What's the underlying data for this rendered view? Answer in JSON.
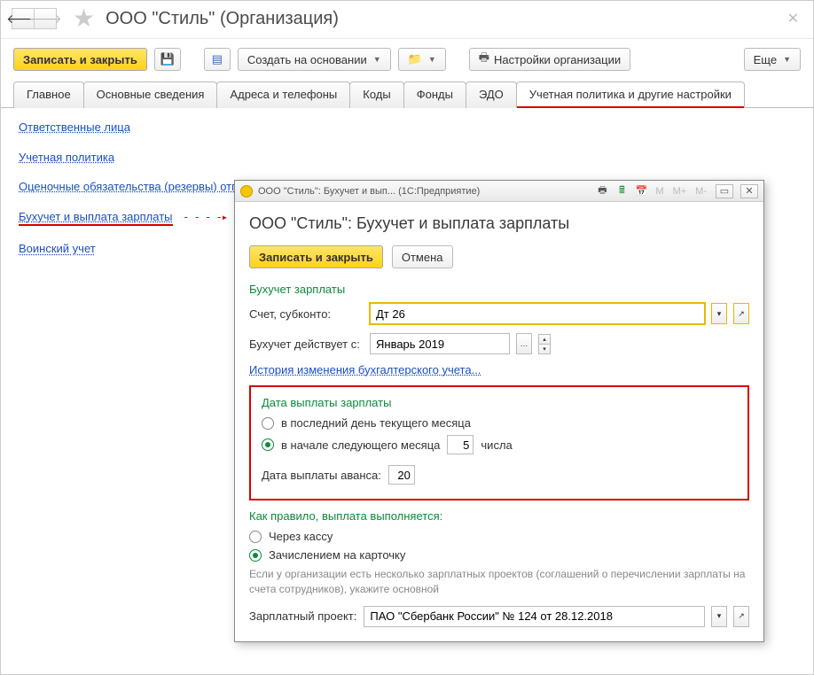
{
  "header": {
    "title": "ООО \"Стиль\" (Организация)"
  },
  "toolbar": {
    "save_close": "Записать и закрыть",
    "create_based_on": "Создать на основании",
    "org_settings": "Настройки организации",
    "more": "Еще"
  },
  "tabs": [
    "Главное",
    "Основные сведения",
    "Адреса и телефоны",
    "Коды",
    "Фонды",
    "ЭДО",
    "Учетная политика и другие настройки"
  ],
  "links": {
    "responsible": "Ответственные лица",
    "policy": "Учетная политика",
    "reserves": "Оценочные обязательства (резервы) отпусков",
    "payroll": "Бухучет и выплата зарплаты",
    "military": "Воинский учет"
  },
  "popup": {
    "titlebar": "ООО \"Стиль\": Бухучет и вып...  (1С:Предприятие)",
    "heading": "ООО \"Стиль\": Бухучет и выплата зарплаты",
    "save_close": "Записать и закрыть",
    "cancel": "Отмена",
    "section_accounting": "Бухучет зарплаты",
    "account_label": "Счет, субконто:",
    "account_value": "Дт 26",
    "effective_label": "Бухучет действует с:",
    "effective_value": "Январь 2019",
    "history_link": "История изменения бухгалтерского учета...",
    "section_paydate": "Дата выплаты зарплаты",
    "opt_last_day": "в последний день текущего месяца",
    "opt_next_month_a": "в начале следующего месяца",
    "opt_next_month_day": "5",
    "opt_next_month_b": "числа",
    "advance_label": "Дата выплаты аванса:",
    "advance_value": "20",
    "section_payment_method": "Как правило, выплата выполняется:",
    "opt_cash": "Через кассу",
    "opt_card": "Зачислением на карточку",
    "hint": "Если у организации есть несколько зарплатных проектов (соглашений о перечислении зарплаты на счета сотрудников), укажите основной",
    "project_label": "Зарплатный проект:",
    "project_value": "ПАО \"Сбербанк России\" № 124 от 28.12.2018"
  }
}
